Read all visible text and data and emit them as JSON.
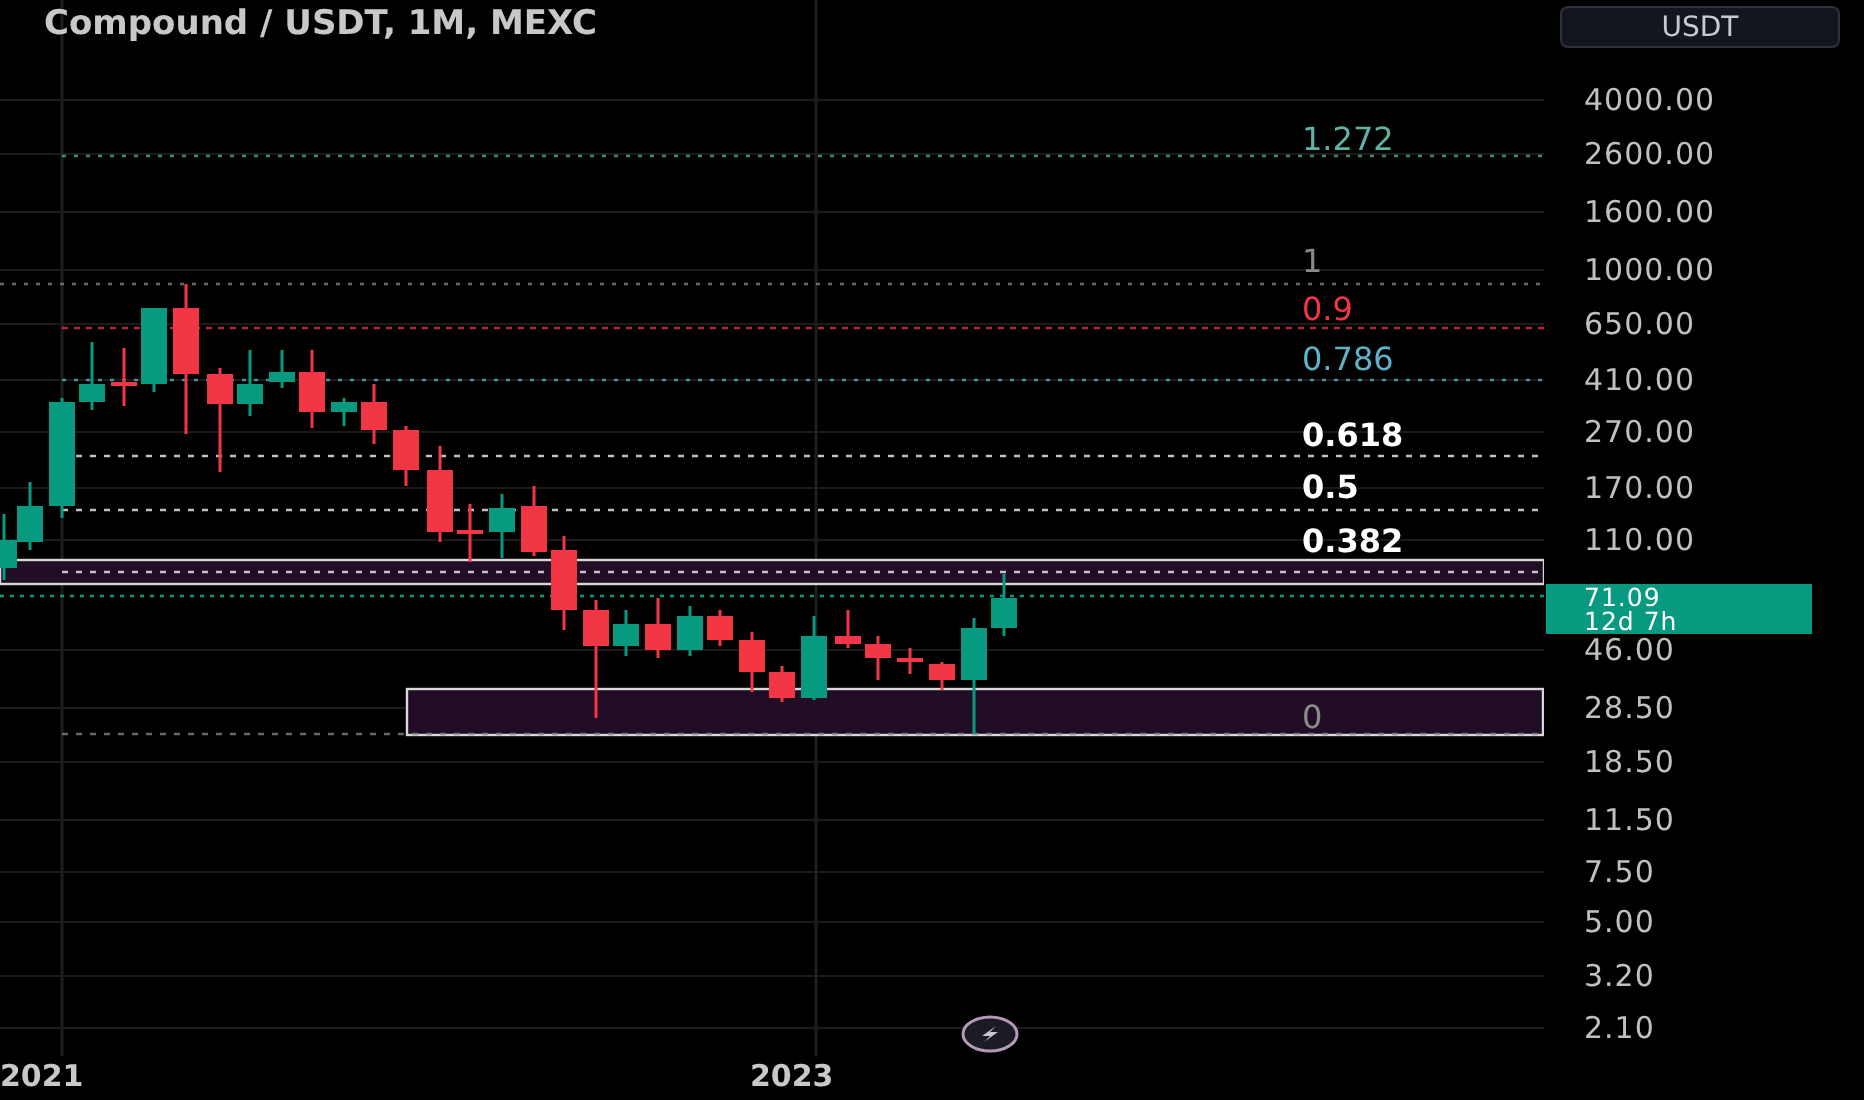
{
  "header": {
    "title": "Compound / USDT, 1M, MEXC",
    "currency_button": "USDT"
  },
  "chart": {
    "fib_levels": [
      {
        "label": "1.272",
        "color": "#5fb3a6"
      },
      {
        "label": "1",
        "color": "#8a8a8a"
      },
      {
        "label": "0.9",
        "color": "#f23645"
      },
      {
        "label": "0.786",
        "color": "#5fb3c6"
      },
      {
        "label": "0.618",
        "color": "#ffffff"
      },
      {
        "label": "0.5",
        "color": "#ffffff"
      },
      {
        "label": "0.382",
        "color": "#ffffff"
      },
      {
        "label": "0",
        "color": "#8a8a8a"
      }
    ],
    "price_axis": [
      "4000.00",
      "2600.00",
      "1600.00",
      "1000.00",
      "650.00",
      "410.00",
      "270.00",
      "170.00",
      "110.00",
      "46.00",
      "28.50",
      "18.50",
      "11.50",
      "7.50",
      "5.00",
      "3.20",
      "2.10"
    ],
    "last_price": {
      "price": "71.09",
      "countdown": "12d 7h"
    },
    "time_axis": [
      "2021",
      "2023"
    ]
  }
}
